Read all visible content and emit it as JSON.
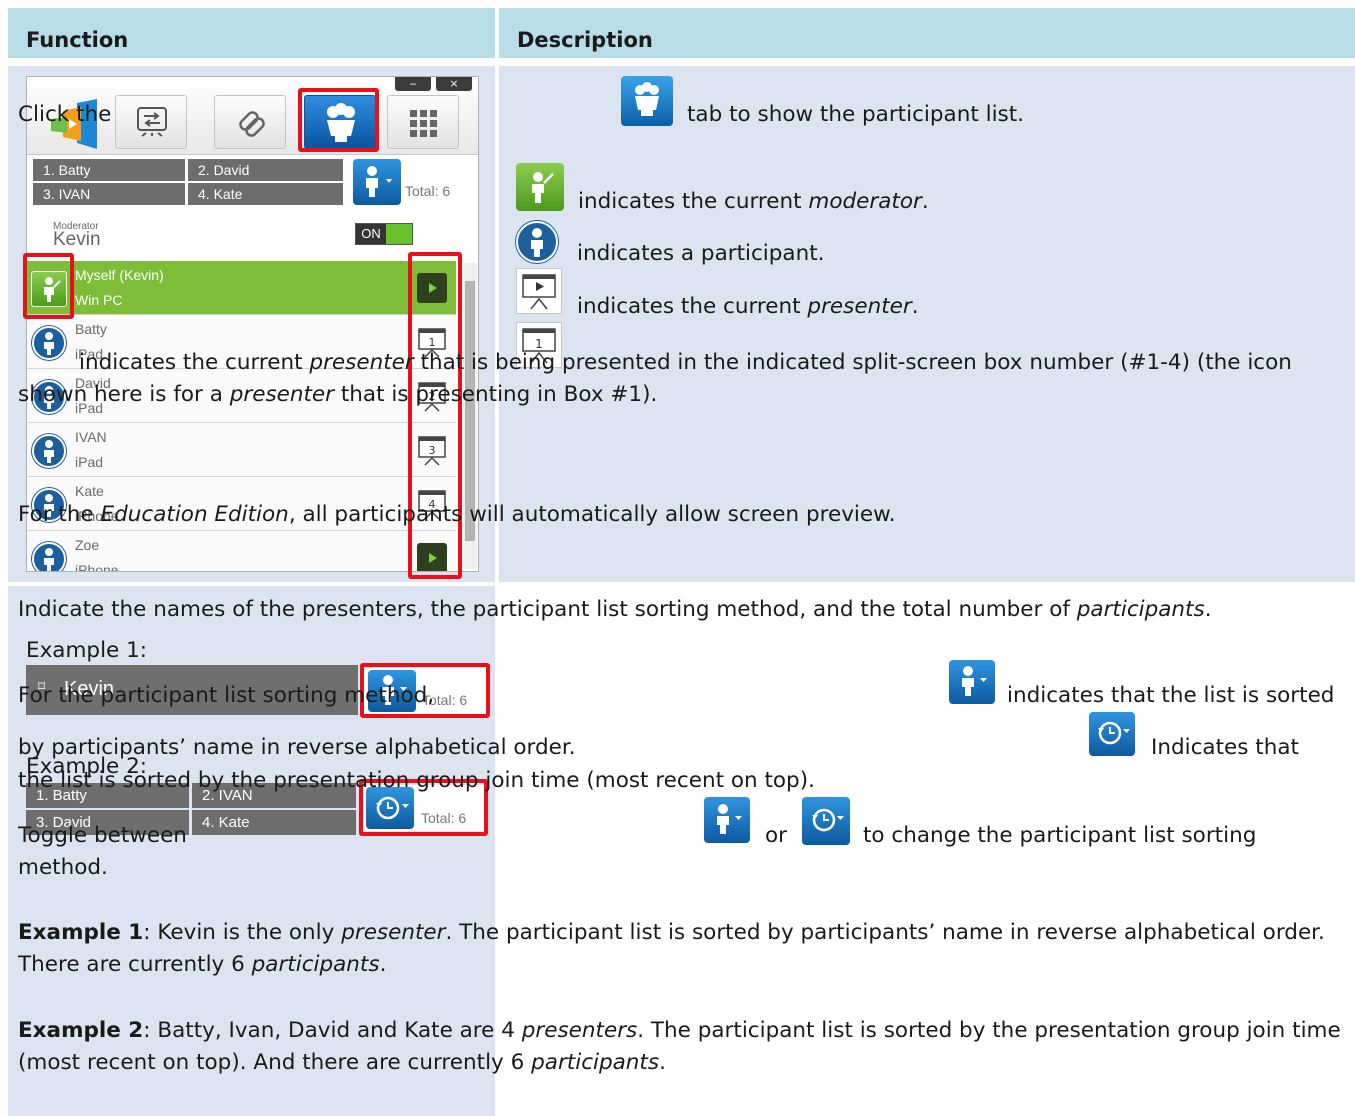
{
  "headers": {
    "function": "Function",
    "description": "Description"
  },
  "window": {
    "min_label": "‒",
    "close_label": "×",
    "grid": [
      "1. Batty",
      "2. David",
      "3. IVAN",
      "4. Kate"
    ],
    "total": "Total: 6",
    "moderator_caption": "Moderator",
    "moderator_name": "Kevin",
    "toggle_label": "ON",
    "rows": [
      {
        "name": "Myself (Kevin)",
        "device": "Win PC",
        "action": "play"
      },
      {
        "name": "Batty",
        "device": "iPad",
        "action": "1"
      },
      {
        "name": "David",
        "device": "iPad",
        "action": "2"
      },
      {
        "name": "IVAN",
        "device": "iPad",
        "action": "3"
      },
      {
        "name": "Kate",
        "device": "iPhone",
        "action": "4"
      },
      {
        "name": "Zoe",
        "device": "iPhone",
        "action": "play"
      }
    ]
  },
  "desc1": {
    "click_pre": "Click the",
    "click_post": "tab to show the participant list.",
    "mod_pre": "indicates the current ",
    "mod_em": "moderator",
    "part": "indicates a participant.",
    "pres_pre": "indicates the current ",
    "pres_em": "presenter",
    "box_pre": "indicates the current ",
    "box_em": "presenter",
    "box_mid": " that is being presented in the indicated split-screen box number (#1-4) (the icon shown here is for a ",
    "box_em2": "presenter",
    "box_post": " that is presenting in Box #1).",
    "edu_pre": "For the ",
    "edu_em": "Education Edition",
    "edu_post": ", all participants will automatically allow screen preview."
  },
  "examples": {
    "ex1_label": "Example 1:",
    "ex1_name": "Kevin",
    "ex2_label": "Example 2:",
    "ex2_grid": [
      "1. Batty",
      "2. IVAN",
      "3. David",
      "4. Kate"
    ],
    "total": "Total: 6"
  },
  "desc2": {
    "intro_pre": "Indicate the names of the presenters, the participant list sorting method, and the total number of ",
    "intro_em": "participants",
    "sort_pre": "For the participant list sorting method,",
    "sort_mid1": "indicates that the list is sorted",
    "sort_mid2": "by participants’ name in reverse alphabetical order.",
    "sort_mid3": "Indicates that",
    "sort_post": "the list is sorted by the presentation group join time (most recent on top).",
    "toggle_pre": "Toggle between",
    "toggle_or": "or",
    "toggle_post": "to change the participant list sorting",
    "toggle_end": "method.",
    "ex1_b": "Example 1",
    "ex1_t1": ": Kevin is the only ",
    "ex1_em1": "presenter",
    "ex1_t2": ". The participant list is sorted by participants’ name in reverse alphabetical order. There are currently 6 ",
    "ex1_em2": "participants",
    "ex2_b": "Example 2",
    "ex2_t1": ": Batty, Ivan, David and Kate are 4 ",
    "ex2_em1": "presenters",
    "ex2_t2": ". The participant list is sorted by the presentation group join time (most recent on top). And there are currently 6 ",
    "ex2_em2": "participants"
  }
}
